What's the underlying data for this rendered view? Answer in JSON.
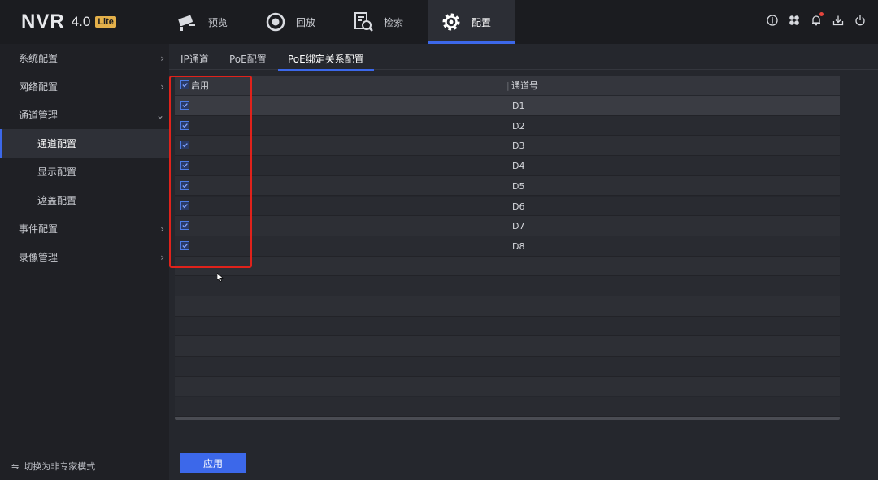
{
  "logo": {
    "main": "NVR",
    "version": "4.0",
    "badge": "Lite"
  },
  "nav": [
    {
      "label": "预览",
      "icon": "camera-icon"
    },
    {
      "label": "回放",
      "icon": "playback-icon"
    },
    {
      "label": "检索",
      "icon": "search-doc-icon"
    },
    {
      "label": "配置",
      "icon": "gear-icon",
      "active": true
    }
  ],
  "top_icons": [
    "info-icon",
    "fan-icon",
    "bell-icon",
    "download-icon",
    "power-icon"
  ],
  "sidebar": {
    "items": [
      {
        "label": "系统配置",
        "arrow": "›"
      },
      {
        "label": "网络配置",
        "arrow": "›"
      },
      {
        "label": "通道管理",
        "arrow": "⌄"
      },
      {
        "label": "通道配置"
      },
      {
        "label": "显示配置"
      },
      {
        "label": "遮盖配置"
      },
      {
        "label": "事件配置",
        "arrow": "›"
      },
      {
        "label": "录像管理",
        "arrow": "›"
      }
    ],
    "mode_switch": "切换为非专家模式"
  },
  "tabs": [
    "IP通道",
    "PoE配置",
    "PoE绑定关系配置"
  ],
  "table": {
    "headers": {
      "enable": "启用",
      "channel": "通道号"
    },
    "rows": [
      {
        "enabled": true,
        "channel": "D1"
      },
      {
        "enabled": true,
        "channel": "D2"
      },
      {
        "enabled": true,
        "channel": "D3"
      },
      {
        "enabled": true,
        "channel": "D4"
      },
      {
        "enabled": true,
        "channel": "D5"
      },
      {
        "enabled": true,
        "channel": "D6"
      },
      {
        "enabled": true,
        "channel": "D7"
      },
      {
        "enabled": true,
        "channel": "D8"
      }
    ]
  },
  "apply_label": "应用",
  "colors": {
    "accent": "#3c68ea",
    "highlight": "#e0221b",
    "badge": "#e4b04a"
  }
}
